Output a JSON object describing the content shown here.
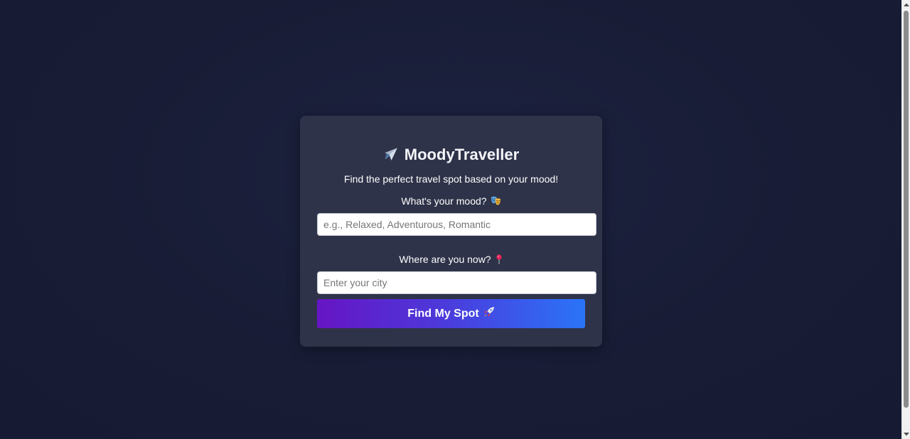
{
  "app": {
    "title": "MoodyTraveller",
    "subtitle": "Find the perfect travel spot based on your mood!"
  },
  "form": {
    "mood_label": "What's your mood?",
    "mood_placeholder": "e.g., Relaxed, Adventurous, Romantic",
    "mood_value": "",
    "city_label": "Where are you now?",
    "city_placeholder": "Enter your city",
    "city_value": "",
    "submit_label": "Find My Spot"
  },
  "icons": {
    "title_icon": "airplane-icon",
    "mood_icon": "theater-masks-icon",
    "city_icon": "round-pushpin-icon",
    "submit_icon": "rocket-icon"
  },
  "colors": {
    "background": "#181c35",
    "card": "#2f3349",
    "button_gradient_start": "#6615c4",
    "button_gradient_end": "#2a74f7"
  }
}
